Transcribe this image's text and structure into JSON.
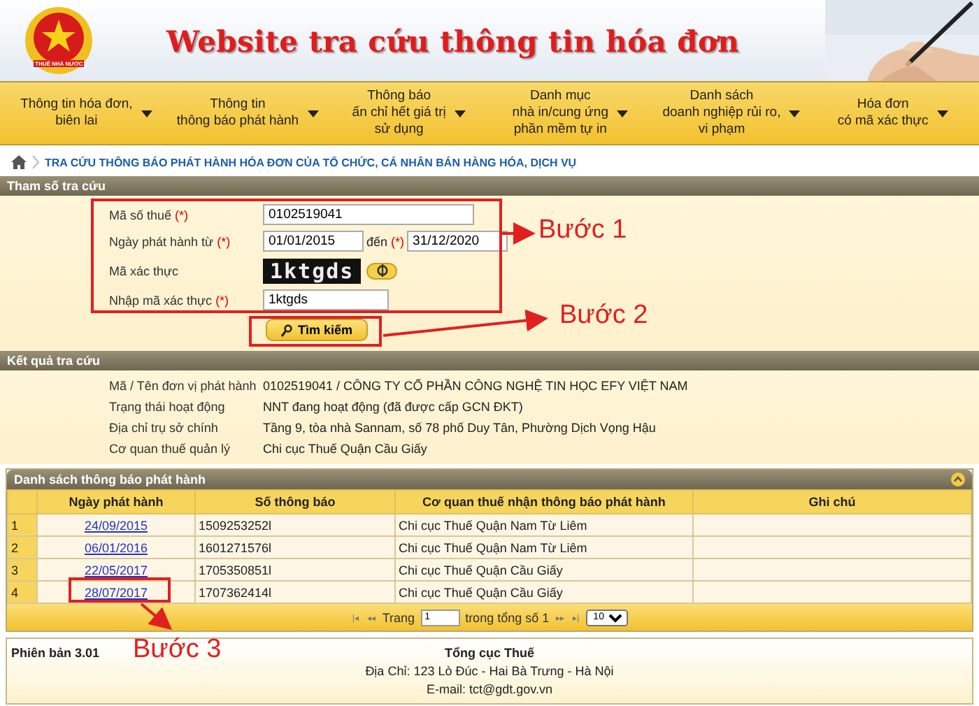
{
  "header": {
    "logo_text": "THUẾ NHÀ NƯỚC",
    "title": "Website tra cứu thông tin hóa đơn"
  },
  "nav": [
    {
      "lines": [
        "Thông tin hóa đơn,",
        "biên lai"
      ]
    },
    {
      "lines": [
        "Thông tin",
        "thông báo phát hành"
      ]
    },
    {
      "lines": [
        "Thông báo",
        "ấn chỉ hết giá trị",
        "sử dụng"
      ]
    },
    {
      "lines": [
        "Danh mục",
        "nhà in/cung ứng",
        "phần mềm tự in"
      ]
    },
    {
      "lines": [
        "Danh sách",
        "doanh nghiệp rủi ro,",
        "vi phạm"
      ]
    },
    {
      "lines": [
        "Hóa đơn",
        "có mã xác thực"
      ]
    }
  ],
  "breadcrumb": "TRA CỨU THÔNG BÁO PHÁT HÀNH HÓA ĐƠN CỦA TỔ CHỨC, CÁ NHÂN BÁN HÀNG HÓA, DỊCH VỤ",
  "search": {
    "title": "Tham số tra cứu",
    "required_mark": "(*)",
    "tax_label": "Mã số thuế",
    "tax_value": "0102519041",
    "date_label": "Ngày phát hành từ",
    "date_from": "01/01/2015",
    "date_to_label": "đến",
    "date_to": "31/12/2020",
    "captcha_label": "Mã xác thực",
    "captcha": "1ktgds",
    "captcha_input_label": "Nhập mã xác thực",
    "captcha_input": "1ktgds",
    "button": "Tìm kiếm"
  },
  "result": {
    "title": "Kết quả tra cứu",
    "rows": [
      {
        "label": "Mã / Tên đơn vị phát hành",
        "value": "0102519041 / CÔNG TY CỔ PHẦN CÔNG NGHỆ TIN HỌC EFY VIỆT NAM"
      },
      {
        "label": "Trạng thái hoạt động",
        "value": "NNT đang hoạt động (đã được cấp GCN ĐKT)"
      },
      {
        "label": "Địa chỉ trụ sở chính",
        "value": "Tầng 9, tòa nhà Sannam, số 78 phố Duy Tân, Phường Dịch Vọng Hậu"
      },
      {
        "label": "Cơ quan thuế quản lý",
        "value": "Chi cục Thuế Quận Cầu Giấy"
      }
    ]
  },
  "list": {
    "title": "Danh sách thông báo phát hành",
    "columns": [
      "Ngày phát hành",
      "Số thông báo",
      "Cơ quan thuế nhận thông báo phát hành",
      "Ghi chú"
    ],
    "rows": [
      {
        "no": "1",
        "date": "24/09/2015",
        "number": "1509253252l",
        "agency": "Chi cục Thuế Quận Nam Từ Liêm"
      },
      {
        "no": "2",
        "date": "06/01/2016",
        "number": "1601271576l",
        "agency": "Chi cục Thuế Quận Nam Từ Liêm"
      },
      {
        "no": "3",
        "date": "22/05/2017",
        "number": "1705350851l",
        "agency": "Chi cục Thuế Quận Cầu Giấy"
      },
      {
        "no": "4",
        "date": "28/07/2017",
        "number": "1707362414l",
        "agency": "Chi cục Thuế Quận Cầu Giấy"
      }
    ],
    "pager": {
      "first": "|◂",
      "prev": "◂◂",
      "page_label": "Trang",
      "page": "1",
      "total": "trong tổng số 1",
      "next": "▸▸",
      "last": "▸|",
      "page_size": "10"
    }
  },
  "footer": {
    "version": "Phiên bản 3.01",
    "org": "Tổng cục Thuế",
    "address": "Địa Chỉ: 123 Lò Đúc - Hai Bà Trưng - Hà Nội",
    "email": "E-mail: tct@gdt.gov.vn"
  },
  "annotations": [
    "Bước 1",
    "Bước 2",
    "Bước 3"
  ]
}
